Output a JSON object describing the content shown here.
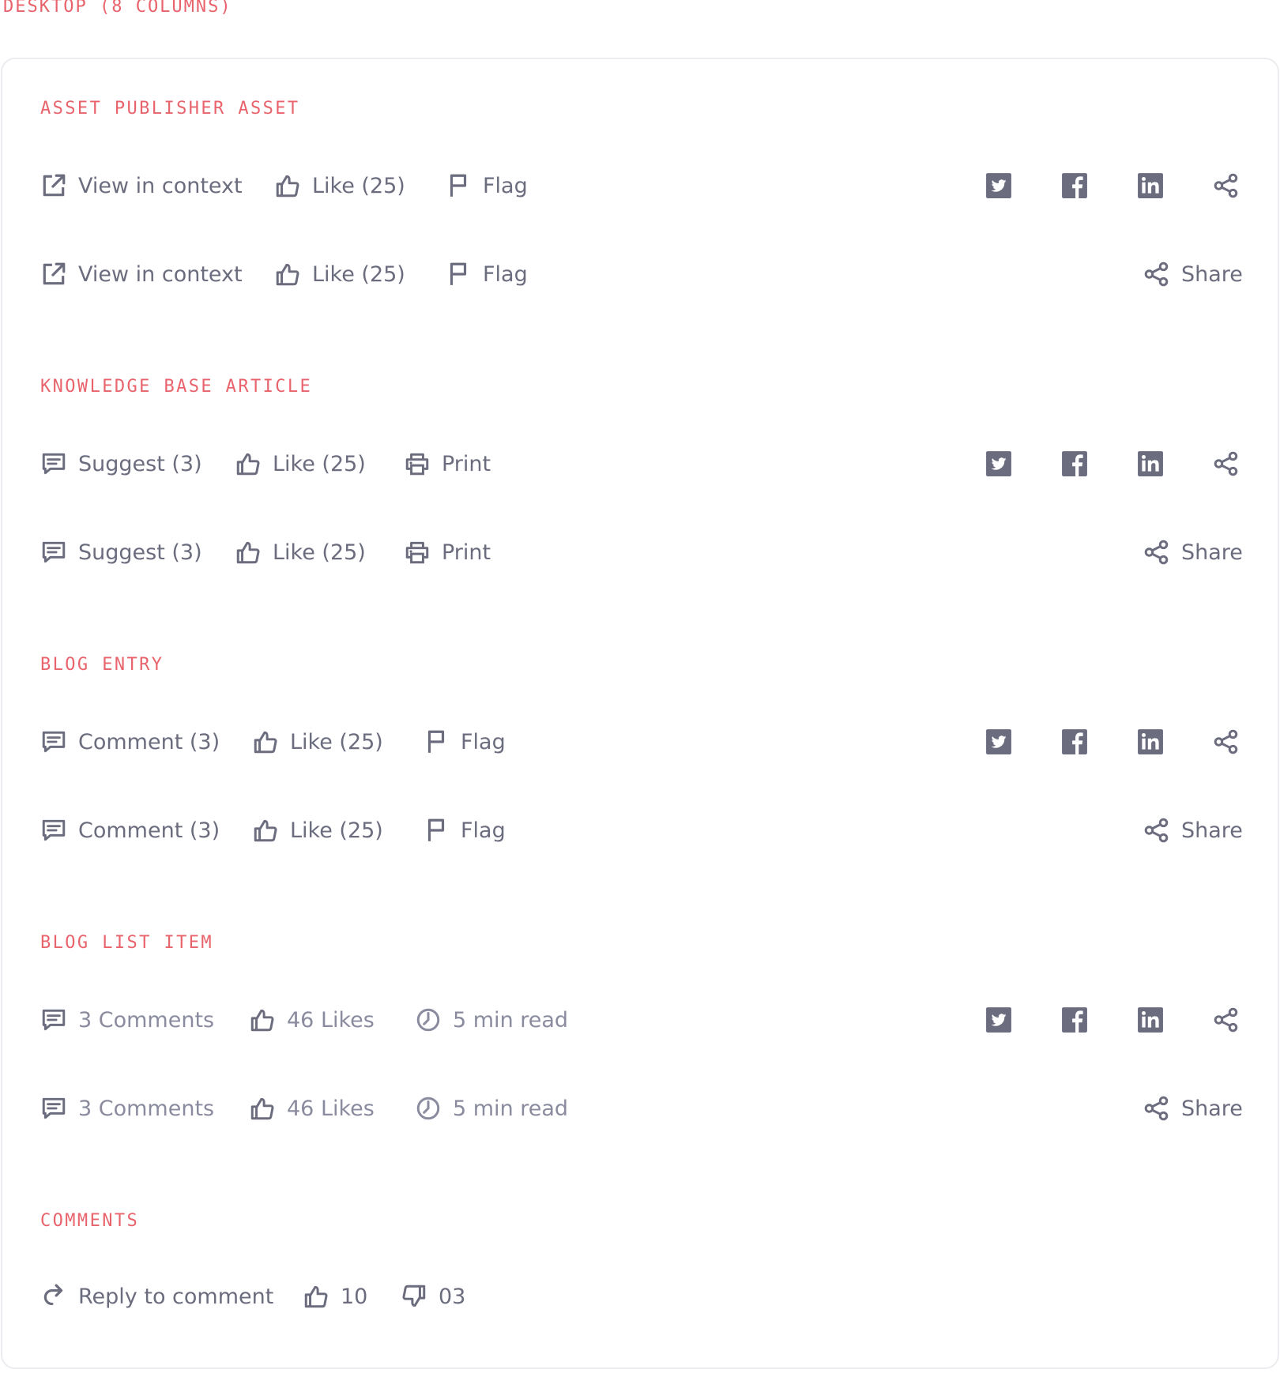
{
  "page_label": "DESKTOP (8 COLUMNS)",
  "colors": {
    "accent": "#e8636b",
    "icon": "#6b6c7e",
    "border": "#ececf0"
  },
  "share_label": "Share",
  "sections": {
    "asset": {
      "title": "ASSET PUBLISHER ASSET",
      "view": "View in context",
      "like": "Like (25)",
      "flag": "Flag"
    },
    "kb": {
      "title": "KNOWLEDGE BASE ARTICLE",
      "suggest": "Suggest (3)",
      "like": "Like (25)",
      "print": "Print"
    },
    "blog": {
      "title": "BLOG ENTRY",
      "comment": "Comment (3)",
      "like": "Like (25)",
      "flag": "Flag"
    },
    "bloglist": {
      "title": "BLOG LIST ITEM",
      "comments": "3 Comments",
      "likes": "46 Likes",
      "read": "5 min read"
    },
    "comments": {
      "title": "COMMENTS",
      "reply": "Reply to comment",
      "up": "10",
      "down": "03"
    }
  }
}
